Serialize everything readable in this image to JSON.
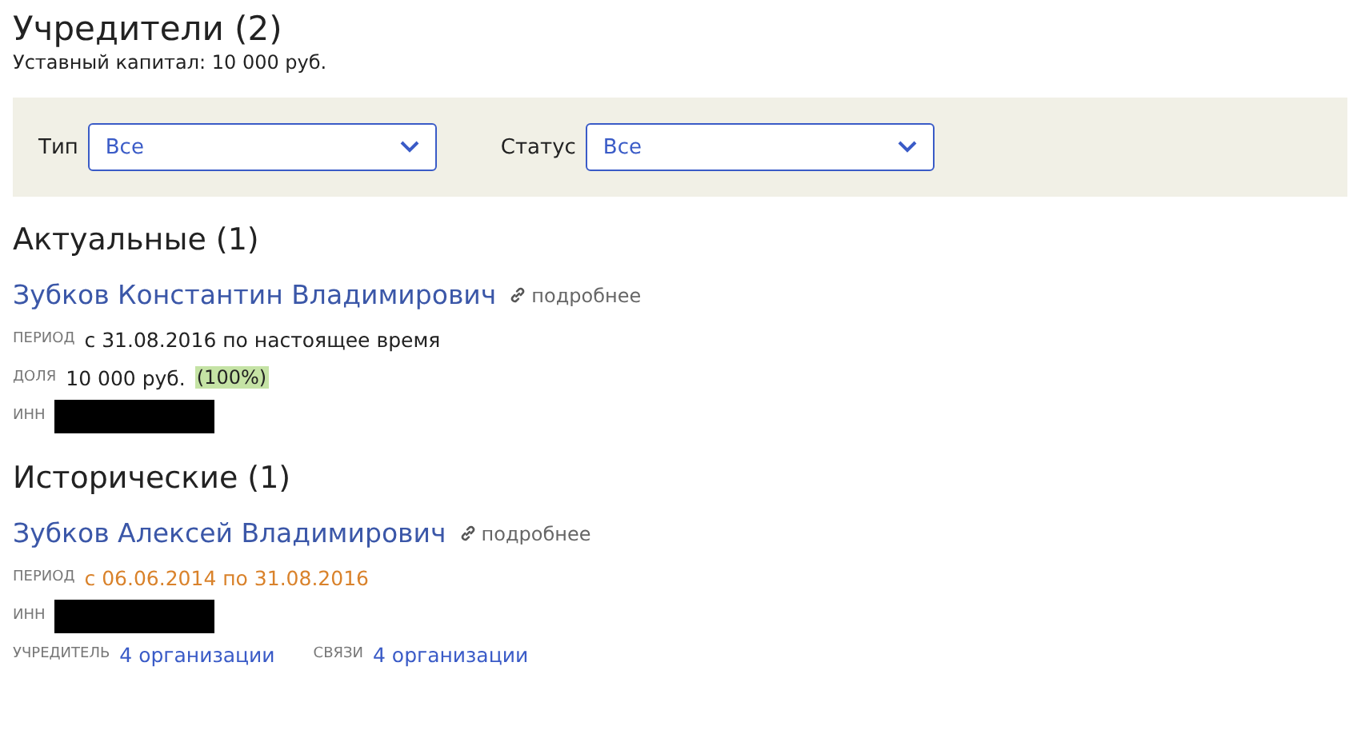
{
  "title": "Учредители (2)",
  "capital": "Уставный капитал: 10 000 руб.",
  "filters": [
    {
      "label": "Тип",
      "value": "Все"
    },
    {
      "label": "Статус",
      "value": "Все"
    }
  ],
  "sections": [
    {
      "title": "Актуальные (1)",
      "people": [
        {
          "name": "Зубков Константин Владимирович",
          "more": "подробнее",
          "rows": [
            {
              "kind": "period",
              "label": "ПЕРИОД",
              "value": "с 31.08.2016 по настоящее время",
              "expired": false
            },
            {
              "kind": "share",
              "label": "ДОЛЯ",
              "value": "10 000 руб.",
              "percent": "(100%)"
            },
            {
              "kind": "redacted",
              "label": "ИНН"
            }
          ]
        }
      ]
    },
    {
      "title": "Исторические (1)",
      "people": [
        {
          "name": "Зубков Алексей Владимирович",
          "more": "подробнее",
          "rows": [
            {
              "kind": "period",
              "label": "ПЕРИОД",
              "value": "с 06.06.2014 по 31.08.2016",
              "expired": true
            },
            {
              "kind": "redacted",
              "label": "ИНН"
            },
            {
              "kind": "links",
              "items": [
                {
                  "label": "УЧРЕДИТЕЛЬ",
                  "value": "4 организации"
                },
                {
                  "label": "СВЯЗИ",
                  "value": "4 организации"
                }
              ]
            }
          ]
        }
      ]
    }
  ]
}
